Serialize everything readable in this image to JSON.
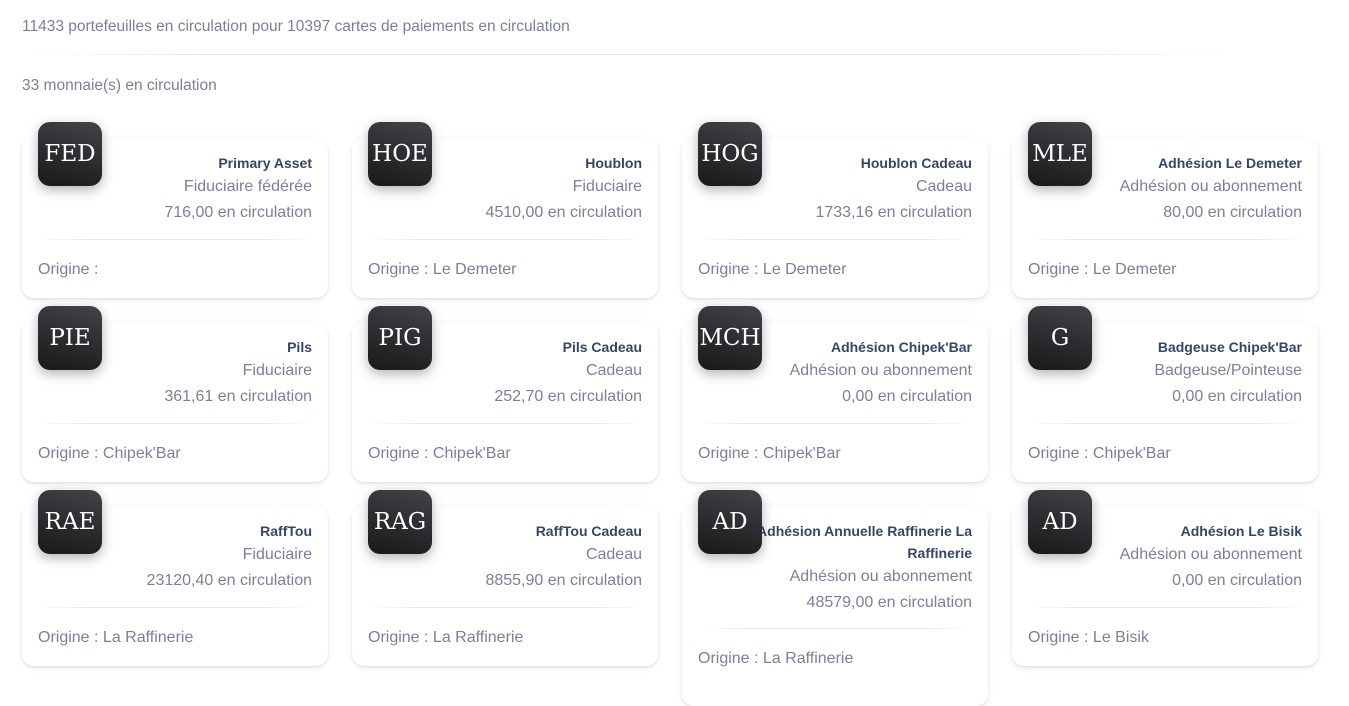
{
  "header": {
    "summary": "11433 portefeuilles en circulation pour 10397 cartes de paiements en circulation",
    "count": "33 monnaie(s) en circulation"
  },
  "cards": [
    {
      "code": "FED",
      "name": "Primary Asset",
      "type": "Fiduciaire fédérée",
      "circulation": "716,00 en circulation",
      "origin": "Origine :"
    },
    {
      "code": "HOE",
      "name": "Houblon",
      "type": "Fiduciaire",
      "circulation": "4510,00 en circulation",
      "origin": "Origine : Le Demeter"
    },
    {
      "code": "HOG",
      "name": "Houblon Cadeau",
      "type": "Cadeau",
      "circulation": "1733,16 en circulation",
      "origin": "Origine : Le Demeter"
    },
    {
      "code": "MLE",
      "name": "Adhésion Le Demeter",
      "type": "Adhésion ou abonnement",
      "circulation": "80,00 en circulation",
      "origin": "Origine : Le Demeter"
    },
    {
      "code": "PIE",
      "name": "Pils",
      "type": "Fiduciaire",
      "circulation": "361,61 en circulation",
      "origin": "Origine : Chipek'Bar"
    },
    {
      "code": "PIG",
      "name": "Pils Cadeau",
      "type": "Cadeau",
      "circulation": "252,70 en circulation",
      "origin": "Origine : Chipek'Bar"
    },
    {
      "code": "MCH",
      "name": "Adhésion Chipek'Bar",
      "type": "Adhésion ou abonnement",
      "circulation": "0,00 en circulation",
      "origin": "Origine : Chipek'Bar"
    },
    {
      "code": "G",
      "name": "Badgeuse Chipek'Bar",
      "type": "Badgeuse/Pointeuse",
      "circulation": "0,00 en circulation",
      "origin": "Origine : Chipek'Bar"
    },
    {
      "code": "RAE",
      "name": "RaffTou",
      "type": "Fiduciaire",
      "circulation": "23120,40 en circulation",
      "origin": "Origine : La Raffinerie"
    },
    {
      "code": "RAG",
      "name": "RaffTou Cadeau",
      "type": "Cadeau",
      "circulation": "8855,90 en circulation",
      "origin": "Origine : La Raffinerie"
    },
    {
      "code": "AD",
      "name": "Adhésion Annuelle Raffinerie La Raffinerie",
      "type": "Adhésion ou abonnement",
      "circulation": "48579,00 en circulation",
      "origin": "Origine : La Raffinerie"
    },
    {
      "code": "AD",
      "name": "Adhésion Le Bisik",
      "type": "Adhésion ou abonnement",
      "circulation": "0,00 en circulation",
      "origin": "Origine : Le Bisik"
    }
  ]
}
